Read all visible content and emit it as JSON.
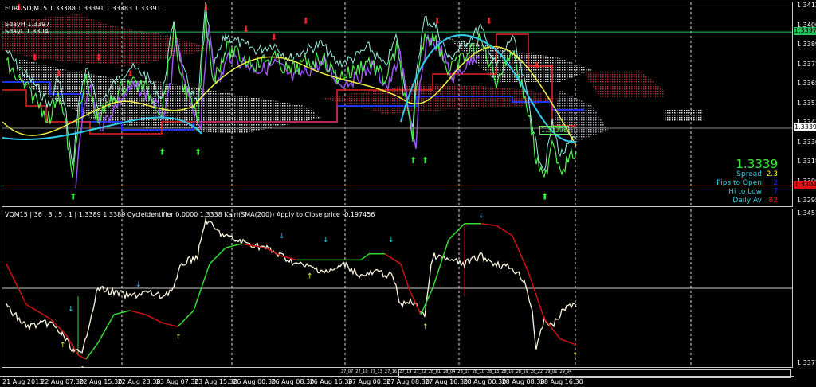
{
  "header": {
    "symbol_line": "EURUSD,M15  1.33388 1.33391 1.33383 1.33391",
    "day_high": "SdayH 1.3397",
    "day_low": "SdayL 1.3304"
  },
  "indicator_header": "VQM15 | 36 , 3 , 5 , 1 |  1.3389 1.3389  CycleIdentifier 0.0000 1.3338  Kairi(SMA(200)) Apply to Close price -0.197456",
  "price_axis": {
    "ticks": [
      1.34125,
      1.34005,
      1.3389,
      1.3377,
      1.33655,
      1.33535,
      1.3342,
      1.333,
      1.33185,
      1.33065,
      1.3295
    ],
    "range": [
      1.3295,
      1.34125
    ],
    "tags": [
      {
        "label": "1.33971",
        "value": 1.33971,
        "bg": "#22c55e",
        "fg": "#000000"
      },
      {
        "label": "1.33391",
        "value": 1.33391,
        "bg": "#ffffff",
        "fg": "#000000"
      },
      {
        "label": "1.33044",
        "value": 1.33044,
        "bg": "#dd1111",
        "fg": "#000000"
      }
    ],
    "inline_label": "1.33396"
  },
  "indicator_axis": {
    "top": "1.3451",
    "bottom": "1.3377",
    "range": [
      1.3377,
      1.3451
    ],
    "level": 1.3414
  },
  "info_panel": {
    "price": "1.3339",
    "rows": [
      {
        "label": "Spread",
        "value": "2.3",
        "color": "#ffff33"
      },
      {
        "label": "Pips to Open",
        "value": "2",
        "color": "#2233ee"
      },
      {
        "label": "Hi to Low",
        "value": "7",
        "color": "#2233ee"
      },
      {
        "label": "Daily Av",
        "value": "82",
        "color": "#ee2222"
      }
    ]
  },
  "time_axis": [
    "21 Aug 2013",
    "22 Aug 07:30",
    "22 Aug 15:30",
    "22 Aug 23:30",
    "23 Aug 07:30",
    "23 Aug 15:30",
    "26 Aug 00:30",
    "26 Aug 08:30",
    "26 Aug 16:30",
    "27 Aug 00:30",
    "27 Aug 08:30",
    "27 Aug 16:30",
    "28 Aug 00:30",
    "28 Aug 08:30",
    "28 Aug 16:30"
  ],
  "mini_labels": [
    "27_07",
    "27_10",
    "27_13",
    "27_16",
    "27_19",
    "27_22",
    "28_01",
    "28_04",
    "28_07",
    "28_10",
    "28_13",
    "28_16",
    "28_19",
    "28_22",
    "29_01",
    "29_04"
  ],
  "colors": {
    "price_line": "#55ee55",
    "close_line": "#99eedd",
    "purple": "#9955ee",
    "yellow": "#eeee44",
    "cyan": "#33ccee",
    "blue": "#2233ee",
    "red": "#ee2222",
    "white_line": "#fff8e0",
    "kairi_up": "#33dd33",
    "kairi_down": "#cc1111"
  },
  "chart_data": {
    "type": "line",
    "main_series": {
      "name": "EURUSD M15 close",
      "points": [
        [
          5,
          1.3378
        ],
        [
          20,
          1.3368
        ],
        [
          40,
          1.3358
        ],
        [
          60,
          1.3344
        ],
        [
          70,
          1.3363
        ],
        [
          80,
          1.3339
        ],
        [
          88,
          1.3306
        ],
        [
          95,
          1.3344
        ],
        [
          105,
          1.3368
        ],
        [
          120,
          1.3344
        ],
        [
          140,
          1.3358
        ],
        [
          160,
          1.3368
        ],
        [
          180,
          1.3363
        ],
        [
          200,
          1.3349
        ],
        [
          215,
          1.3397
        ],
        [
          225,
          1.3368
        ],
        [
          245,
          1.3344
        ],
        [
          255,
          1.3406
        ],
        [
          265,
          1.3368
        ],
        [
          280,
          1.3387
        ],
        [
          300,
          1.3382
        ],
        [
          320,
          1.3378
        ],
        [
          340,
          1.3382
        ],
        [
          360,
          1.3373
        ],
        [
          380,
          1.3378
        ],
        [
          400,
          1.3382
        ],
        [
          420,
          1.337
        ],
        [
          440,
          1.3373
        ],
        [
          460,
          1.338
        ],
        [
          480,
          1.3368
        ],
        [
          495,
          1.3387
        ],
        [
          505,
          1.3358
        ],
        [
          515,
          1.3329
        ],
        [
          520,
          1.3368
        ],
        [
          530,
          1.3397
        ],
        [
          545,
          1.3392
        ],
        [
          560,
          1.3373
        ],
        [
          580,
          1.3382
        ],
        [
          600,
          1.3392
        ],
        [
          620,
          1.3368
        ],
        [
          640,
          1.3387
        ],
        [
          660,
          1.3349
        ],
        [
          670,
          1.332
        ],
        [
          680,
          1.3306
        ],
        [
          690,
          1.3334
        ],
        [
          700,
          1.3315
        ],
        [
          720,
          1.3325
        ]
      ]
    },
    "indicator_close": {
      "name": "Close",
      "points": [
        [
          5,
          1.3405
        ],
        [
          30,
          1.3395
        ],
        [
          60,
          1.3397
        ],
        [
          75,
          1.3391
        ],
        [
          90,
          1.3383
        ],
        [
          100,
          1.3381
        ],
        [
          110,
          1.3399
        ],
        [
          120,
          1.3414
        ],
        [
          140,
          1.3412
        ],
        [
          160,
          1.341
        ],
        [
          180,
          1.3412
        ],
        [
          200,
          1.341
        ],
        [
          215,
          1.3414
        ],
        [
          225,
          1.3426
        ],
        [
          245,
          1.343
        ],
        [
          255,
          1.3448
        ],
        [
          270,
          1.3442
        ],
        [
          290,
          1.3438
        ],
        [
          310,
          1.3436
        ],
        [
          330,
          1.3434
        ],
        [
          350,
          1.343
        ],
        [
          370,
          1.3426
        ],
        [
          390,
          1.3424
        ],
        [
          410,
          1.3422
        ],
        [
          430,
          1.3426
        ],
        [
          450,
          1.342
        ],
        [
          470,
          1.3422
        ],
        [
          490,
          1.342
        ],
        [
          500,
          1.3405
        ],
        [
          510,
          1.3408
        ],
        [
          520,
          1.3405
        ],
        [
          530,
          1.3401
        ],
        [
          540,
          1.343
        ],
        [
          560,
          1.3428
        ],
        [
          580,
          1.3426
        ],
        [
          600,
          1.343
        ],
        [
          620,
          1.3426
        ],
        [
          640,
          1.3424
        ],
        [
          655,
          1.3418
        ],
        [
          665,
          1.3403
        ],
        [
          670,
          1.3383
        ],
        [
          680,
          1.3399
        ],
        [
          690,
          1.3395
        ],
        [
          700,
          1.3401
        ],
        [
          710,
          1.3406
        ],
        [
          720,
          1.3405
        ]
      ]
    },
    "indicator_kairi": {
      "name": "Kairi SMA(200)",
      "points": [
        [
          5,
          1.3426
        ],
        [
          30,
          1.3406
        ],
        [
          60,
          1.3399
        ],
        [
          80,
          1.3391
        ],
        [
          95,
          1.3381
        ],
        [
          105,
          1.3379
        ],
        [
          120,
          1.3387
        ],
        [
          140,
          1.3401
        ],
        [
          160,
          1.3403
        ],
        [
          180,
          1.3401
        ],
        [
          200,
          1.3397
        ],
        [
          220,
          1.3395
        ],
        [
          240,
          1.3403
        ],
        [
          260,
          1.3426
        ],
        [
          280,
          1.3434
        ],
        [
          300,
          1.3436
        ],
        [
          330,
          1.3434
        ],
        [
          350,
          1.343
        ],
        [
          370,
          1.3428
        ],
        [
          400,
          1.3428
        ],
        [
          450,
          1.3428
        ],
        [
          460,
          1.3431
        ],
        [
          480,
          1.3431
        ],
        [
          500,
          1.3426
        ],
        [
          510,
          1.3414
        ],
        [
          525,
          1.3401
        ],
        [
          540,
          1.3414
        ],
        [
          560,
          1.3438
        ],
        [
          580,
          1.3446
        ],
        [
          600,
          1.3446
        ],
        [
          620,
          1.3445
        ],
        [
          640,
          1.344
        ],
        [
          660,
          1.3422
        ],
        [
          680,
          1.3399
        ],
        [
          700,
          1.3389
        ],
        [
          720,
          1.3386
        ]
      ]
    },
    "up_arrows": [
      [
        88,
        1.3298
      ],
      [
        200,
        1.3325
      ],
      [
        245,
        1.3325
      ],
      [
        515,
        1.332
      ],
      [
        530,
        1.332
      ],
      [
        680,
        1.3298
      ]
    ],
    "down_arrows": [
      [
        20,
        1.341
      ],
      [
        40,
        1.338
      ],
      [
        70,
        1.337
      ],
      [
        120,
        1.338
      ],
      [
        160,
        1.337
      ],
      [
        255,
        1.341
      ],
      [
        305,
        1.3397
      ],
      [
        340,
        1.3392
      ],
      [
        380,
        1.3402
      ],
      [
        545,
        1.3402
      ],
      [
        610,
        1.3402
      ],
      [
        670,
        1.3375
      ]
    ]
  }
}
